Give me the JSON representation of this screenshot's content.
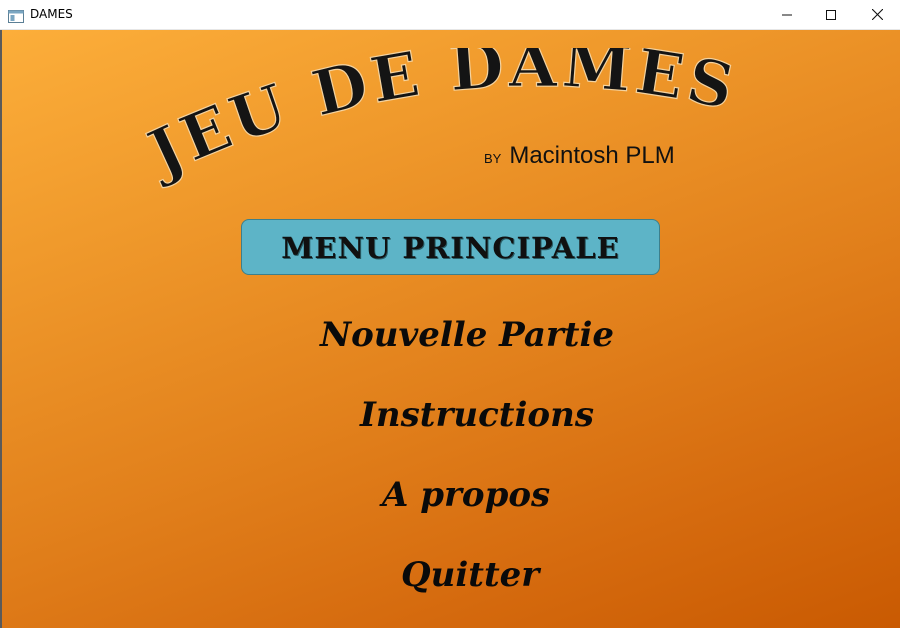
{
  "window": {
    "title": "DAMES",
    "icon": "app-window-icon",
    "controls": {
      "minimize_icon": "minimize-icon",
      "maximize_icon": "maximize-icon",
      "close_icon": "close-icon"
    }
  },
  "header": {
    "title": "JEU DE DAMES",
    "by": "BY",
    "author": "Macintosh PLM"
  },
  "menu": {
    "heading": "MENU PRINCIPALE",
    "items": [
      {
        "label": "Nouvelle Partie"
      },
      {
        "label": "Instructions"
      },
      {
        "label": "A propos"
      },
      {
        "label": "Quitter"
      }
    ]
  },
  "colors": {
    "background_start": "#fcae3a",
    "background_end": "#c95a02",
    "menu_header_bg": "#5db4c7",
    "text": "#0a0a0a"
  }
}
